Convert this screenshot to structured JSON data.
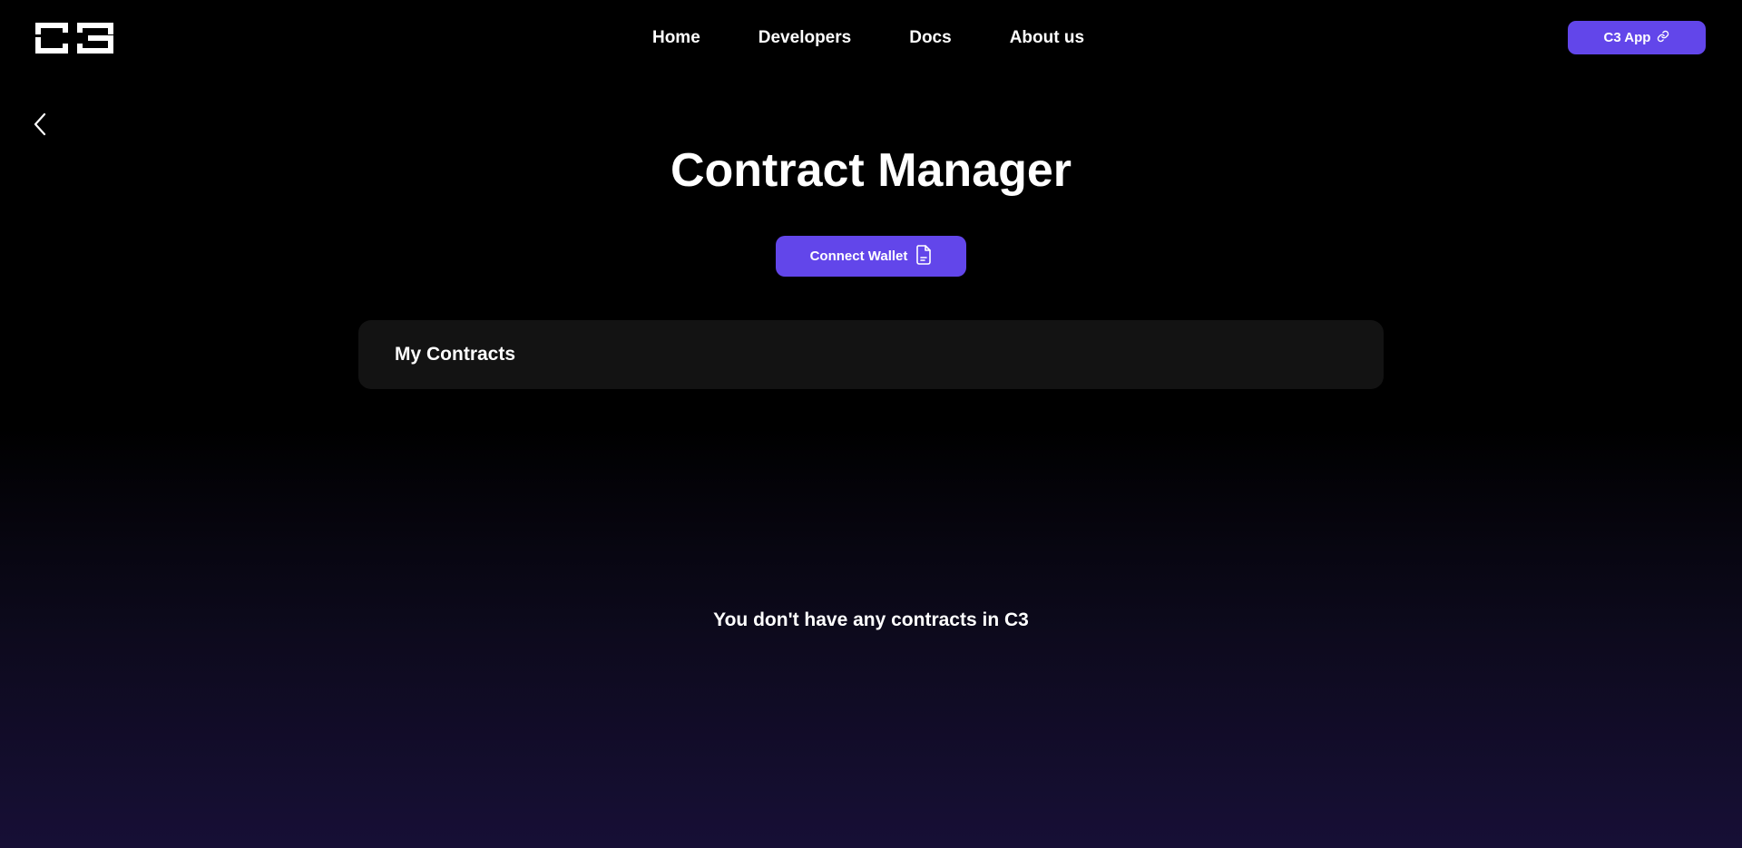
{
  "header": {
    "logo_icon": "c3-logo-icon",
    "nav_items": [
      {
        "label": "Home"
      },
      {
        "label": "Developers"
      },
      {
        "label": "Docs"
      },
      {
        "label": "About us"
      }
    ],
    "app_button": {
      "label": "C3 App",
      "icon": "link-icon"
    }
  },
  "main": {
    "back_icon": "chevron-left-icon",
    "title": "Contract Manager",
    "connect_wallet": {
      "label": "Connect Wallet",
      "icon": "document-icon"
    },
    "contracts_panel": {
      "title": "My Contracts"
    },
    "empty_message": "You don't have any contracts in C3"
  },
  "colors": {
    "accent": "#6246ea",
    "background": "#000000",
    "background_bottom": "#170f36",
    "panel": "#131313",
    "text": "#ffffff"
  }
}
